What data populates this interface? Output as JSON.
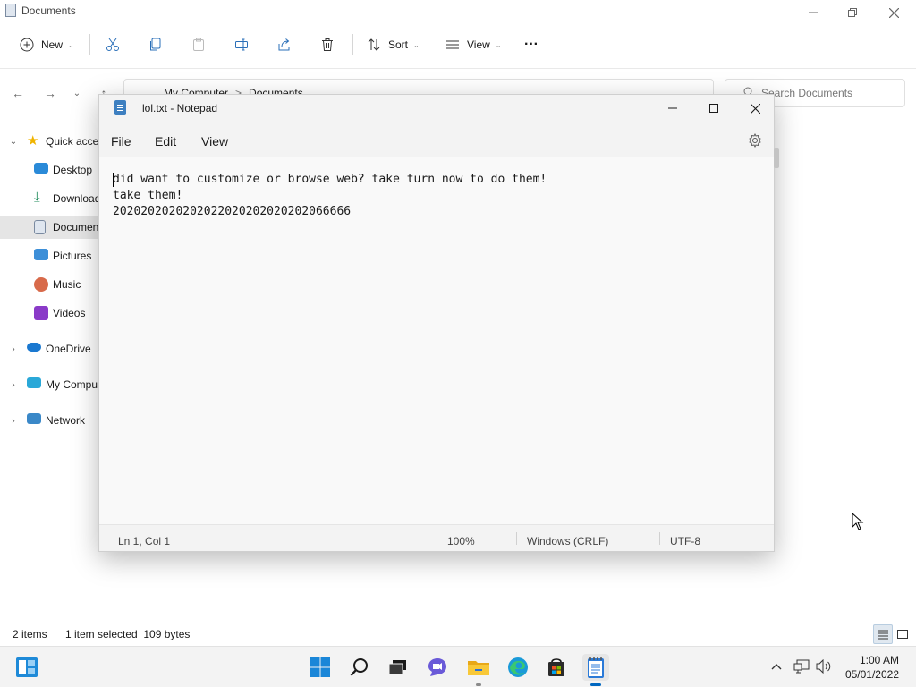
{
  "explorer": {
    "title": "Documents",
    "toolbar": {
      "new_label": "New",
      "sort_label": "Sort",
      "view_label": "View",
      "more_label": "···"
    },
    "address": {
      "crumb1": "My Computer",
      "sep": ">",
      "crumb2": "Documents"
    },
    "search": {
      "placeholder": "Search Documents"
    },
    "sidebar": {
      "quick_access": "Quick access",
      "desktop": "Desktop",
      "downloads": "Downloads",
      "documents": "Documents",
      "pictures": "Pictures",
      "music": "Music",
      "videos": "Videos",
      "onedrive": "OneDrive",
      "my_computer": "My Computer",
      "network": "Network"
    },
    "status": {
      "items": "2 items",
      "selected": "1 item selected  109 bytes"
    }
  },
  "notepad": {
    "title": "lol.txt - Notepad",
    "menu": {
      "file": "File",
      "edit": "Edit",
      "view": "View"
    },
    "content": "did want to customize or browse web? take turn now to do them!\ntake them!\n2020202020202022020202020202066666",
    "status": {
      "position": "Ln 1, Col 1",
      "zoom": "100%",
      "line_ending": "Windows (CRLF)",
      "encoding": "UTF-8"
    }
  },
  "taskbar": {
    "time": "1:00 AM",
    "date": "05/01/2022"
  },
  "colors": {
    "accent": "#0067c0",
    "folder": "#f0c040",
    "selection": "#e5e5e5"
  }
}
